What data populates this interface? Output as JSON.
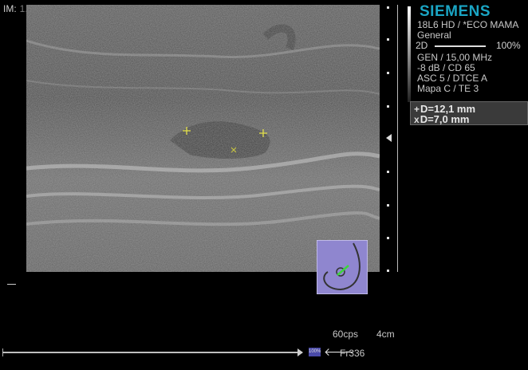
{
  "header": {
    "im_label": "IM:",
    "im_value": "1.0"
  },
  "brand": {
    "name": "SIEMENS",
    "color": "#1aa5c4"
  },
  "info": {
    "transducer": "18L6 HD / *ECO MAMA",
    "preset": "General",
    "mode": "2D",
    "power": "100%",
    "freq": "GEN / 15,00 MHz",
    "gain": "-8 dB / CD 65",
    "asc": "ASC 5 / DTCE A",
    "map": "Mapa C / TE 3"
  },
  "measurements": [
    {
      "marker": "+",
      "text": "D=12,1 mm"
    },
    {
      "marker": "x",
      "text": "D=7,0 mm"
    }
  ],
  "status": {
    "frame_rate": "60cps",
    "depth": "4cm",
    "frame": "Fr336",
    "badge": "100%"
  },
  "icons": {
    "lock": "lock-icon",
    "probe_position": "breast-bodymarker-icon",
    "back": "back-arrow-icon",
    "play": "play-icon"
  }
}
